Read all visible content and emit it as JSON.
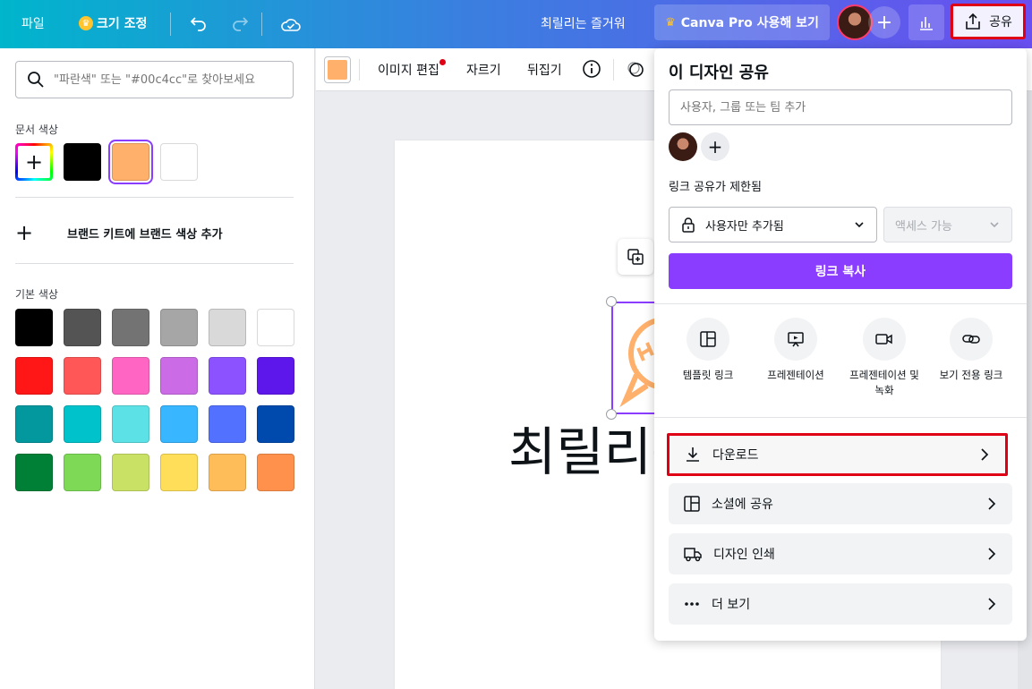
{
  "topbar": {
    "file": "파일",
    "resize": "크기 조정",
    "title": "최릴리는 즐거워",
    "pro": "Canva Pro 사용해 보기",
    "share": "공유",
    "colors": {
      "accent": "#8b3dff",
      "highlight": "#e00016"
    }
  },
  "left_panel": {
    "search_placeholder": "\"파란색\" 또는 \"#00c4cc\"로 찾아보세요",
    "document_colors_label": "문서 색상",
    "document_colors": [
      "#000000",
      "#ffb06b",
      "#ffffff"
    ],
    "brand_kit_label": "브랜드 키트에 브랜드 색상 추가",
    "default_colors_label": "기본 색상",
    "default_colors": [
      "#000000",
      "#545454",
      "#737373",
      "#a6a6a6",
      "#d9d9d9",
      "#ffffff",
      "#ff1616",
      "#ff5757",
      "#ff66c4",
      "#cb6ce6",
      "#8c52ff",
      "#5e17eb",
      "#03989e",
      "#00c2cb",
      "#5ce1e6",
      "#38b6ff",
      "#5271ff",
      "#004aad",
      "#008037",
      "#7ed957",
      "#c9e265",
      "#ffde59",
      "#ffbd59",
      "#ff914d"
    ]
  },
  "canvas_toolbar": {
    "color": "#ffb06b",
    "edit_image": "이미지 편집",
    "crop": "자르기",
    "flip": "뒤집기"
  },
  "canvas": {
    "text": "최릴리는"
  },
  "share_panel": {
    "title": "이 디자인 공유",
    "input_placeholder": "사용자, 그룹 또는 팀 추가",
    "link_restricted": "링크 공유가 제한됨",
    "access_select": "사용자만 추가됨",
    "access_level": "액세스 가능",
    "copy_link": "링크 복사",
    "options": [
      {
        "label": "템플릿 링크",
        "icon": "template-icon"
      },
      {
        "label": "프레젠테이션",
        "icon": "presentation-icon"
      },
      {
        "label": "프레젠테이션 및 녹화",
        "icon": "video-record-icon"
      },
      {
        "label": "보기 전용 링크",
        "icon": "link-icon"
      }
    ],
    "rows": [
      {
        "label": "다운로드",
        "icon": "download-icon"
      },
      {
        "label": "소셜에 공유",
        "icon": "social-icon"
      },
      {
        "label": "디자인 인쇄",
        "icon": "truck-icon"
      },
      {
        "label": "더 보기",
        "icon": "more-icon"
      }
    ]
  }
}
